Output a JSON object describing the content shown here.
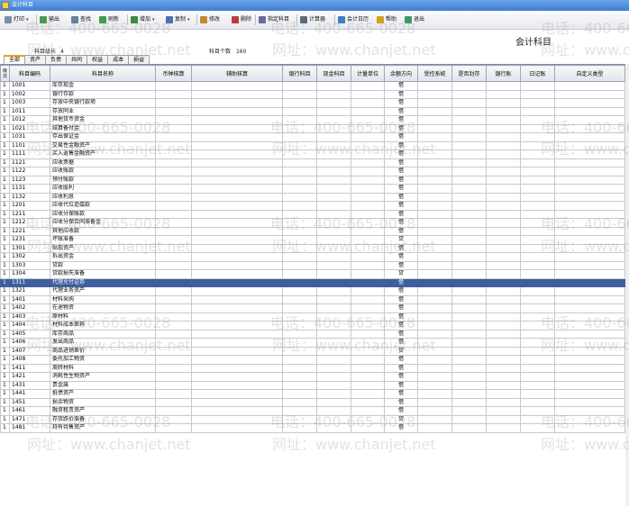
{
  "window": {
    "title": "会计科目"
  },
  "toolbar": {
    "items": [
      {
        "label": "打印",
        "icon": "printer-icon",
        "dropdown": true
      },
      {
        "label": "输出",
        "icon": "export-icon",
        "dropdown": false
      },
      {
        "label": "查找",
        "icon": "search-icon",
        "dropdown": false
      },
      {
        "label": "刷新",
        "icon": "refresh-icon",
        "dropdown": false
      },
      {
        "label": "增加",
        "icon": "add-icon",
        "dropdown": true
      },
      {
        "label": "复制",
        "icon": "copy-icon",
        "dropdown": true
      },
      {
        "label": "修改",
        "icon": "edit-icon",
        "dropdown": false
      },
      {
        "label": "删除",
        "icon": "delete-icon",
        "dropdown": false
      },
      {
        "label": "指定科目",
        "icon": "assign-icon",
        "dropdown": false
      },
      {
        "label": "计算器",
        "icon": "calculator-icon",
        "dropdown": false
      },
      {
        "label": "会计日历",
        "icon": "calendar-icon",
        "dropdown": false
      },
      {
        "label": "帮助",
        "icon": "help-icon",
        "dropdown": false
      },
      {
        "label": "退出",
        "icon": "exit-icon",
        "dropdown": false
      }
    ]
  },
  "page": {
    "heading": "会计科目",
    "code_length_label": "科目级长",
    "code_length_value": "4",
    "count_label": "科目个数",
    "count_value": "160"
  },
  "tabs": [
    "全部",
    "资产",
    "负债",
    "共同",
    "权益",
    "成本",
    "损益"
  ],
  "table": {
    "columns": [
      "级次",
      "科目编码",
      "科目名称",
      "币种核算",
      "辅助核算",
      "银行科目",
      "现金科目",
      "计量单位",
      "余额方向",
      "受控系统",
      "是否封存",
      "银行账",
      "日记账",
      "自定义类型"
    ],
    "selected_index": 23,
    "rows": [
      [
        "1",
        "1001",
        "库存现金",
        "借"
      ],
      [
        "1",
        "1002",
        "银行存款",
        "借"
      ],
      [
        "1",
        "1003",
        "存放中央银行款项",
        "借"
      ],
      [
        "1",
        "1011",
        "存放同业",
        "借"
      ],
      [
        "1",
        "1012",
        "其他货币资金",
        "借"
      ],
      [
        "1",
        "1021",
        "结算备付金",
        "借"
      ],
      [
        "1",
        "1031",
        "存出保证金",
        "借"
      ],
      [
        "1",
        "1101",
        "交易性金融资产",
        "借"
      ],
      [
        "1",
        "1111",
        "买入返售金融资产",
        "借"
      ],
      [
        "1",
        "1121",
        "应收票据",
        "借"
      ],
      [
        "1",
        "1122",
        "应收账款",
        "借"
      ],
      [
        "1",
        "1123",
        "预付账款",
        "借"
      ],
      [
        "1",
        "1131",
        "应收股利",
        "借"
      ],
      [
        "1",
        "1132",
        "应收利息",
        "借"
      ],
      [
        "1",
        "1201",
        "应收代位追偿款",
        "借"
      ],
      [
        "1",
        "1211",
        "应收分保账款",
        "借"
      ],
      [
        "1",
        "1212",
        "应收分保合同准备金",
        "借"
      ],
      [
        "1",
        "1221",
        "其他应收款",
        "借"
      ],
      [
        "1",
        "1231",
        "坏账准备",
        "贷"
      ],
      [
        "1",
        "1301",
        "贴现资产",
        "借"
      ],
      [
        "1",
        "1302",
        "拆出资金",
        "借"
      ],
      [
        "1",
        "1303",
        "贷款",
        "借"
      ],
      [
        "1",
        "1304",
        "贷款损失准备",
        "贷"
      ],
      [
        "1",
        "1311",
        "代理兑付证券",
        "借"
      ],
      [
        "1",
        "1321",
        "代理业务资产",
        "借"
      ],
      [
        "1",
        "1401",
        "材料采购",
        "借"
      ],
      [
        "1",
        "1402",
        "在途物资",
        "借"
      ],
      [
        "1",
        "1403",
        "原材料",
        "借"
      ],
      [
        "1",
        "1404",
        "材料成本差异",
        "借"
      ],
      [
        "1",
        "1405",
        "库存商品",
        "借"
      ],
      [
        "1",
        "1406",
        "发出商品",
        "借"
      ],
      [
        "1",
        "1407",
        "商品进销差价",
        "贷"
      ],
      [
        "1",
        "1408",
        "委托加工物资",
        "借"
      ],
      [
        "1",
        "1411",
        "周转材料",
        "借"
      ],
      [
        "1",
        "1421",
        "消耗性生物资产",
        "借"
      ],
      [
        "1",
        "1431",
        "贵金属",
        "借"
      ],
      [
        "1",
        "1441",
        "抵债资产",
        "借"
      ],
      [
        "1",
        "1451",
        "损余物资",
        "借"
      ],
      [
        "1",
        "1461",
        "融资租赁资产",
        "借"
      ],
      [
        "1",
        "1471",
        "存货跌价准备",
        "贷"
      ],
      [
        "1",
        "1481",
        "持有待售资产",
        "借"
      ]
    ]
  },
  "watermark": {
    "phone": "电话：400-665-0028",
    "site": "网址：www.chanjet.net"
  },
  "colors": {
    "selected_row": "#3d5f9c",
    "title_bar": "#3c7ed4",
    "active_tab": "#f0a020"
  }
}
